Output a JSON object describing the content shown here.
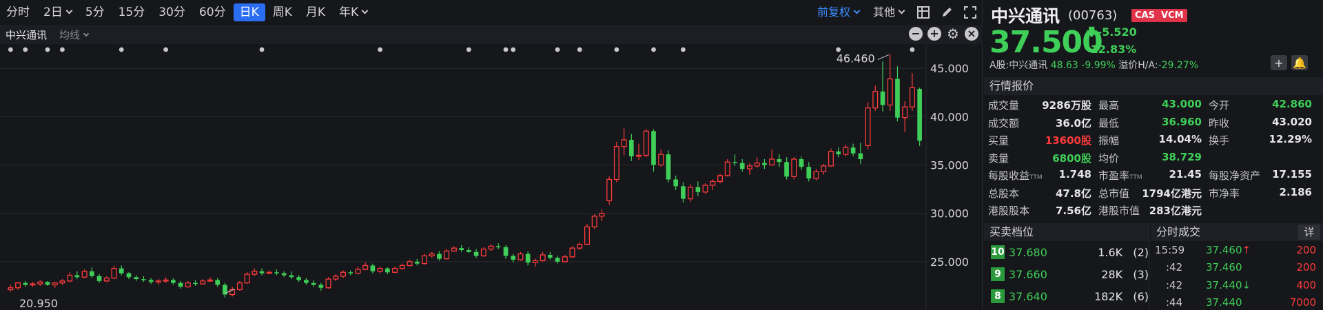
{
  "toolbar": {
    "periods": [
      "分时",
      "2日",
      "5分",
      "15分",
      "30分",
      "60分",
      "日K",
      "周K",
      "月K",
      "年K"
    ],
    "period_dropdowns": [
      false,
      true,
      false,
      false,
      false,
      false,
      false,
      false,
      false,
      true
    ],
    "active_period": "日K",
    "adjust_label": "前复权",
    "other_label": "其他"
  },
  "subbar": {
    "title": "中兴通讯",
    "ma_label": "均线"
  },
  "chart_data": {
    "type": "candlestick",
    "ylim": [
      20,
      47.5
    ],
    "ticks": [
      25.0,
      30.0,
      35.0,
      40.0,
      45.0
    ],
    "tick_labels": [
      "25.000",
      "30.000",
      "35.000",
      "40.000",
      "45.000"
    ],
    "annotations": {
      "high_label": "46.460",
      "low_label": "20.950"
    },
    "up_color": "#ff3b3b",
    "down_color": "#3fcf58",
    "candles": [
      [
        22.1,
        22.6,
        21.9,
        22.3
      ],
      [
        22.3,
        22.9,
        22.1,
        22.8
      ],
      [
        22.8,
        23.0,
        22.4,
        22.6
      ],
      [
        22.6,
        22.9,
        22.4,
        22.7
      ],
      [
        22.7,
        23.1,
        22.5,
        22.9
      ],
      [
        22.9,
        23.0,
        22.5,
        22.6
      ],
      [
        22.6,
        22.9,
        22.3,
        22.8
      ],
      [
        22.8,
        23.2,
        22.6,
        23.0
      ],
      [
        23.0,
        23.9,
        22.9,
        23.6
      ],
      [
        23.6,
        24.0,
        23.2,
        23.4
      ],
      [
        23.4,
        24.2,
        23.3,
        24.0
      ],
      [
        24.0,
        24.4,
        23.3,
        23.5
      ],
      [
        23.5,
        23.7,
        22.8,
        23.0
      ],
      [
        23.0,
        23.5,
        22.9,
        23.3
      ],
      [
        23.3,
        24.6,
        23.2,
        24.3
      ],
      [
        24.3,
        24.6,
        23.6,
        23.8
      ],
      [
        23.8,
        23.9,
        23.2,
        23.4
      ],
      [
        23.4,
        23.6,
        23.0,
        23.2
      ],
      [
        23.2,
        23.5,
        22.9,
        23.1
      ],
      [
        23.1,
        23.3,
        22.7,
        22.9
      ],
      [
        22.9,
        23.2,
        22.6,
        23.0
      ],
      [
        23.0,
        23.4,
        22.8,
        23.1
      ],
      [
        23.1,
        23.3,
        22.6,
        22.8
      ],
      [
        22.8,
        23.0,
        22.2,
        22.4
      ],
      [
        22.4,
        23.0,
        22.3,
        22.8
      ],
      [
        22.8,
        23.1,
        22.5,
        22.7
      ],
      [
        22.7,
        23.2,
        22.6,
        23.0
      ],
      [
        23.0,
        23.4,
        22.9,
        23.1
      ],
      [
        23.1,
        23.3,
        22.4,
        22.6
      ],
      [
        22.6,
        22.8,
        21.3,
        21.6
      ],
      [
        21.6,
        22.4,
        21.4,
        22.1
      ],
      [
        22.1,
        23.0,
        22.0,
        22.8
      ],
      [
        22.8,
        23.9,
        22.7,
        23.7
      ],
      [
        23.7,
        24.3,
        23.5,
        24.0
      ],
      [
        24.0,
        24.3,
        23.6,
        23.8
      ],
      [
        23.8,
        24.1,
        23.7,
        23.9
      ],
      [
        23.9,
        24.2,
        23.6,
        23.8
      ],
      [
        23.8,
        24.0,
        23.4,
        23.6
      ],
      [
        23.6,
        24.0,
        23.2,
        23.4
      ],
      [
        23.4,
        23.6,
        22.9,
        23.1
      ],
      [
        23.1,
        23.3,
        22.6,
        22.8
      ],
      [
        22.8,
        23.1,
        22.4,
        22.6
      ],
      [
        22.6,
        22.8,
        22.0,
        22.3
      ],
      [
        22.3,
        23.4,
        22.2,
        23.2
      ],
      [
        23.2,
        23.7,
        23.0,
        23.5
      ],
      [
        23.5,
        24.1,
        23.3,
        23.9
      ],
      [
        23.9,
        24.1,
        23.6,
        23.8
      ],
      [
        23.8,
        24.5,
        23.7,
        24.2
      ],
      [
        24.2,
        24.9,
        24.1,
        24.6
      ],
      [
        24.6,
        24.8,
        23.8,
        24.0
      ],
      [
        24.0,
        24.5,
        23.8,
        24.3
      ],
      [
        24.3,
        24.4,
        23.7,
        23.9
      ],
      [
        23.9,
        24.5,
        23.8,
        24.3
      ],
      [
        24.3,
        24.8,
        24.2,
        24.6
      ],
      [
        24.6,
        25.2,
        24.5,
        25.0
      ],
      [
        25.0,
        25.3,
        24.6,
        24.8
      ],
      [
        24.8,
        25.8,
        24.7,
        25.6
      ],
      [
        25.6,
        26.0,
        25.4,
        25.8
      ],
      [
        25.8,
        26.1,
        25.1,
        25.3
      ],
      [
        25.3,
        26.3,
        25.2,
        26.1
      ],
      [
        26.1,
        26.6,
        26.0,
        26.4
      ],
      [
        26.4,
        26.7,
        26.0,
        26.2
      ],
      [
        26.2,
        26.5,
        25.9,
        26.0
      ],
      [
        26.0,
        26.3,
        25.4,
        25.6
      ],
      [
        25.6,
        26.5,
        25.5,
        26.3
      ],
      [
        26.3,
        26.8,
        26.1,
        26.6
      ],
      [
        26.6,
        26.9,
        26.3,
        26.5
      ],
      [
        26.5,
        26.7,
        25.3,
        25.6
      ],
      [
        25.6,
        25.8,
        24.9,
        25.2
      ],
      [
        25.2,
        26.0,
        25.1,
        25.8
      ],
      [
        25.8,
        26.1,
        24.6,
        24.9
      ],
      [
        24.9,
        25.3,
        24.5,
        25.1
      ],
      [
        25.1,
        26.0,
        25.0,
        25.7
      ],
      [
        25.7,
        26.0,
        25.2,
        25.4
      ],
      [
        25.4,
        25.6,
        24.8,
        25.0
      ],
      [
        25.0,
        25.7,
        24.9,
        25.5
      ],
      [
        25.5,
        26.6,
        25.4,
        26.4
      ],
      [
        26.4,
        27.0,
        26.2,
        26.8
      ],
      [
        26.8,
        28.9,
        26.7,
        28.6
      ],
      [
        28.6,
        29.9,
        28.4,
        29.7
      ],
      [
        29.7,
        30.4,
        29.2,
        30.0
      ],
      [
        31.3,
        33.8,
        30.9,
        33.5
      ],
      [
        33.5,
        37.4,
        33.2,
        36.9
      ],
      [
        36.9,
        38.8,
        36.0,
        37.6
      ],
      [
        37.6,
        38.2,
        35.4,
        35.9
      ],
      [
        35.9,
        37.2,
        35.5,
        36.0
      ],
      [
        36.0,
        38.7,
        35.8,
        38.5
      ],
      [
        38.5,
        38.7,
        34.3,
        35.0
      ],
      [
        35.0,
        36.6,
        34.8,
        36.1
      ],
      [
        36.1,
        36.5,
        33.2,
        33.5
      ],
      [
        33.5,
        33.9,
        32.4,
        32.8
      ],
      [
        32.8,
        33.2,
        31.1,
        31.5
      ],
      [
        31.5,
        33.0,
        31.2,
        32.7
      ],
      [
        32.7,
        33.3,
        31.8,
        32.2
      ],
      [
        32.2,
        33.1,
        32.0,
        32.9
      ],
      [
        32.9,
        33.5,
        32.4,
        33.3
      ],
      [
        33.3,
        34.1,
        33.1,
        33.9
      ],
      [
        33.9,
        35.6,
        33.8,
        35.3
      ],
      [
        35.3,
        36.1,
        34.9,
        35.2
      ],
      [
        35.2,
        35.6,
        34.3,
        34.6
      ],
      [
        34.6,
        35.2,
        34.0,
        34.9
      ],
      [
        34.9,
        35.8,
        34.7,
        35.2
      ],
      [
        35.2,
        35.6,
        34.6,
        35.0
      ],
      [
        35.0,
        36.6,
        34.9,
        35.6
      ],
      [
        35.6,
        36.1,
        34.8,
        35.3
      ],
      [
        35.3,
        35.8,
        33.5,
        33.8
      ],
      [
        33.8,
        35.8,
        33.5,
        35.6
      ],
      [
        35.6,
        35.9,
        34.5,
        34.8
      ],
      [
        34.8,
        35.3,
        33.3,
        33.6
      ],
      [
        33.6,
        34.6,
        33.4,
        34.3
      ],
      [
        34.3,
        35.1,
        34.0,
        34.9
      ],
      [
        34.9,
        36.7,
        34.8,
        36.4
      ],
      [
        36.4,
        36.8,
        35.8,
        36.1
      ],
      [
        36.1,
        37.1,
        35.9,
        36.8
      ],
      [
        36.8,
        37.2,
        35.9,
        36.2
      ],
      [
        36.2,
        37.3,
        35.1,
        35.6
      ],
      [
        37.0,
        41.5,
        36.6,
        40.9
      ],
      [
        40.9,
        43.2,
        40.6,
        42.6
      ],
      [
        42.6,
        45.7,
        40.5,
        41.2
      ],
      [
        41.2,
        46.46,
        40.6,
        43.9
      ],
      [
        43.9,
        45.2,
        39.5,
        39.9
      ],
      [
        39.9,
        41.6,
        38.4,
        41.0
      ],
      [
        41.0,
        44.5,
        40.6,
        43.0
      ],
      [
        42.86,
        43.0,
        36.96,
        37.5
      ]
    ],
    "dot_marker_days": [
      0,
      2,
      5,
      7,
      15,
      21,
      34,
      50,
      62,
      67,
      68,
      74,
      77,
      82,
      87,
      91,
      112,
      122
    ]
  },
  "quote": {
    "name": "中兴通讯",
    "code": "(00763)",
    "badges": [
      "CAS",
      "VCM"
    ],
    "price": "37.500",
    "change": "-5.520",
    "change_pct": "-12.83%",
    "a_share_label": "A股:中兴通讯",
    "a_share_price": "48.63",
    "a_share_pct": "-9.99%",
    "premium_label": "溢价H/A:",
    "premium_value": "-29.27%",
    "quote_section_title": "行情报价",
    "stats": [
      [
        [
          "成交量",
          "9286万股",
          ""
        ],
        [
          "最高",
          "43.000",
          "g"
        ],
        [
          "今开",
          "42.860",
          "g"
        ]
      ],
      [
        [
          "成交额",
          "36.0亿",
          ""
        ],
        [
          "最低",
          "36.960",
          "g"
        ],
        [
          "昨收",
          "43.020",
          ""
        ]
      ],
      [
        [
          "买量",
          "13600股",
          "r"
        ],
        [
          "振幅",
          "14.04%",
          ""
        ],
        [
          "换手",
          "12.29%",
          ""
        ]
      ],
      [
        [
          "卖量",
          "6800股",
          "g"
        ],
        [
          "均价",
          "38.729",
          "g"
        ],
        [
          "",
          "",
          " "
        ]
      ],
      [
        [
          "每股收益",
          "1.748",
          ""
        ],
        [
          "市盈率",
          "21.45",
          ""
        ],
        [
          "每股净资产",
          "17.155",
          ""
        ]
      ],
      [
        [
          "总股本",
          "47.8亿",
          ""
        ],
        [
          "总市值",
          "1794亿港元",
          ""
        ],
        [
          "市净率",
          "2.186",
          ""
        ]
      ],
      [
        [
          "港股股本",
          "7.56亿",
          ""
        ],
        [
          "港股市值",
          "283亿港元",
          ""
        ],
        [
          "",
          "",
          ""
        ]
      ]
    ],
    "ttm_label": "TTM",
    "orderbook_title": "买卖档位",
    "orderbook": [
      {
        "level": "10",
        "price": "37.680",
        "vol": "1.6K",
        "count": "2)"
      },
      {
        "level": "9",
        "price": "37.660",
        "vol": "28K",
        "count": "3)"
      },
      {
        "level": "8",
        "price": "37.640",
        "vol": "182K",
        "count": "6)"
      }
    ],
    "ticks_title": "分时成交",
    "ticks_detail": "详",
    "ticks": [
      {
        "time": "15:59",
        "price": "37.460",
        "arrow": "↑",
        "vol": "200"
      },
      {
        "time": ":42",
        "price": "37.460",
        "arrow": "",
        "vol": "200"
      },
      {
        "time": ":42",
        "price": "37.440",
        "arrow": "↓",
        "vol": "400"
      },
      {
        "time": ":44",
        "price": "37.440",
        "arrow": "",
        "vol": "7000"
      }
    ]
  }
}
